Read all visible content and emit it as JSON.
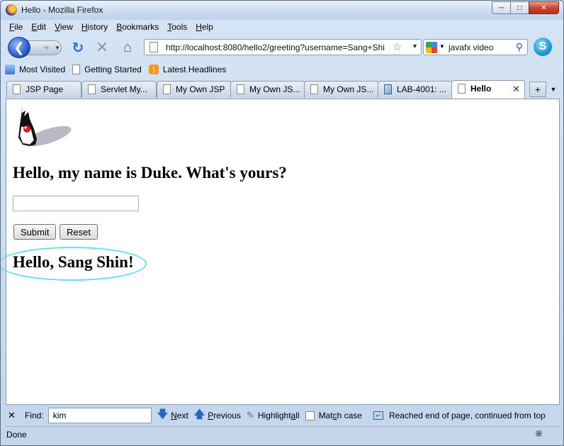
{
  "window": {
    "title": "Hello - Mozilla Firefox"
  },
  "menu": {
    "items": [
      {
        "accel": "F",
        "rest": "ile"
      },
      {
        "accel": "E",
        "rest": "dit"
      },
      {
        "accel": "V",
        "rest": "iew"
      },
      {
        "accel": "H",
        "rest": "istory"
      },
      {
        "accel": "B",
        "rest": "ookmarks"
      },
      {
        "accel": "T",
        "rest": "ools"
      },
      {
        "accel": "H",
        "rest": "elp"
      }
    ]
  },
  "nav": {
    "url": "http://localhost:8080/hello2/greeting?username=Sang+Shi",
    "search_value": "javafx video"
  },
  "bookmarks": [
    {
      "label": "Most Visited",
      "icon": "most-visited-icon"
    },
    {
      "label": "Getting Started",
      "icon": "page-icon"
    },
    {
      "label": "Latest Headlines",
      "icon": "rss-icon"
    }
  ],
  "tabs": [
    {
      "label": "JSP Page"
    },
    {
      "label": "Servlet My..."
    },
    {
      "label": "My Own JSP"
    },
    {
      "label": "My Own JS..."
    },
    {
      "label": "My Own JS..."
    },
    {
      "label": "LAB-4001: ..."
    },
    {
      "label": "Hello",
      "active": true
    }
  ],
  "page": {
    "heading": "Hello, my name is Duke. What's yours?",
    "input_value": "",
    "submit_label": "Submit",
    "reset_label": "Reset",
    "result": "Hello, Sang Shin!",
    "highlight_color": "#5fe0f2"
  },
  "findbar": {
    "label": "Find:",
    "query": "kim",
    "next_accel": "N",
    "next_rest": "ext",
    "previous_accel": "P",
    "previous_rest": "revious",
    "highlight_pre": "Highlight ",
    "highlight_accel": "a",
    "highlight_rest": "ll",
    "match_pre": "Mat",
    "match_accel": "c",
    "match_rest": "h case",
    "status": "Reached end of page, continued from top"
  },
  "status": {
    "text": "Done"
  }
}
